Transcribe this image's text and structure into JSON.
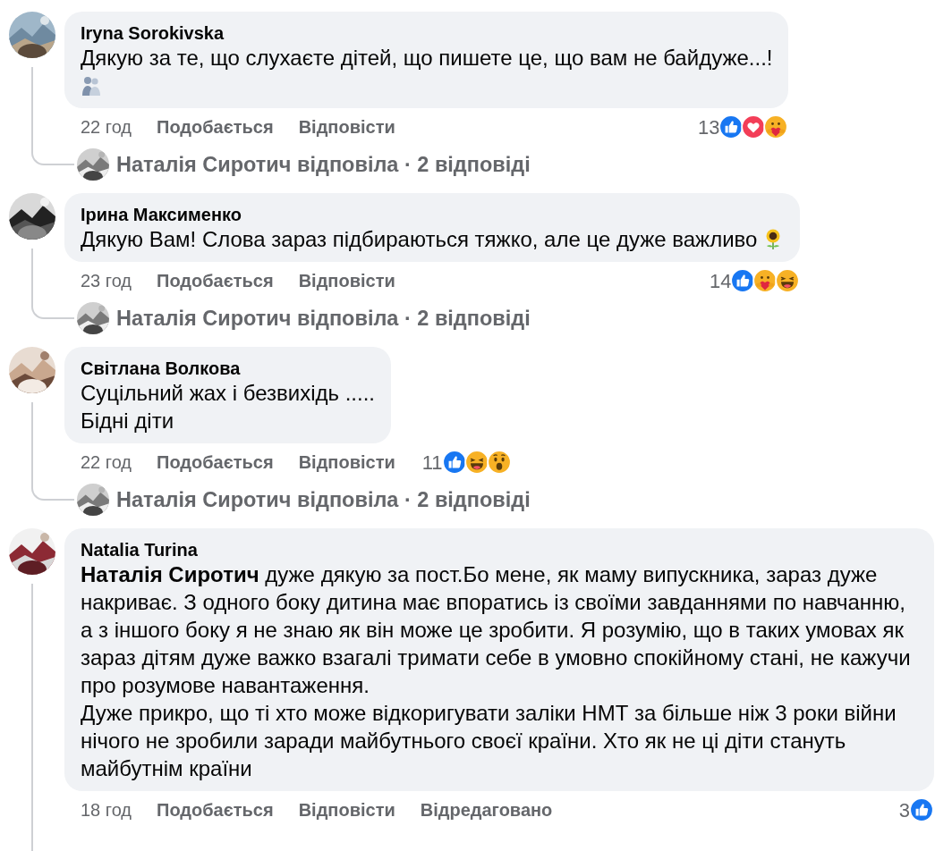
{
  "comments": [
    {
      "author": "Iryna Sorokivska",
      "text": "Дякую за те, що слухаєте дітей, що пишете це, що вам не байдуже...!",
      "trailing_icon": {
        "kind": "hug",
        "own_line": true
      },
      "time": "22 год",
      "like_action": "Подобається",
      "reply_action": "Відповісти",
      "reaction_count": "13",
      "reactions": [
        {
          "kind": "like"
        },
        {
          "kind": "love"
        },
        {
          "kind": "care"
        }
      ],
      "replies_link": {
        "text": "Наталія Сиротич відповіла · 2 відповіді"
      }
    },
    {
      "author": "Ірина Максименко",
      "text": "Дякую Вам! Слова зараз підбираються тяжко, але це дуже важливо",
      "trailing_icon": {
        "kind": "sunflower",
        "own_line": false
      },
      "time": "23 год",
      "like_action": "Подобається",
      "reply_action": "Відповісти",
      "reaction_count": "14",
      "reactions": [
        {
          "kind": "like"
        },
        {
          "kind": "care"
        },
        {
          "kind": "haha"
        }
      ],
      "replies_link": {
        "text": "Наталія Сиротич відповіла · 2 відповіді"
      }
    },
    {
      "author": "Світлана Волкова",
      "text": "Суцільний жах і безвихідь .....\nБідні діти",
      "time": "22 год",
      "like_action": "Подобається",
      "reply_action": "Відповісти",
      "reaction_count": "11",
      "reactions": [
        {
          "kind": "like"
        },
        {
          "kind": "haha"
        },
        {
          "kind": "wow"
        }
      ],
      "replies_link": {
        "text": "Наталія Сиротич відповіла · 2 відповіді"
      }
    },
    {
      "author": "Natalia Turina",
      "text": "**Наталія Сиротич** дуже дякую за пост.Бо мене, як маму випускника, зараз дуже накриває. З одного боку дитина має впоратись із своїми завданнями по навчанню, а з іншого боку я не знаю як він може це зробити. Я розумію, що в таких умовах як зараз дітям дуже важко взагалі тримати себе в умовно спокійному стані, не кажучи про розумове навантаження.\nДуже прикро, що ті хто може відкоригувати заліки НМТ за більше ніж 3 роки війни нічого не зробили заради майбутнього своєї країни. Хто як не ці діти стануть майбутнім країни",
      "time": "18 год",
      "like_action": "Подобається",
      "reply_action": "Відповісти",
      "edited_label": "Відредаговано",
      "reaction_count": "3",
      "reactions": [
        {
          "kind": "like"
        }
      ]
    }
  ]
}
